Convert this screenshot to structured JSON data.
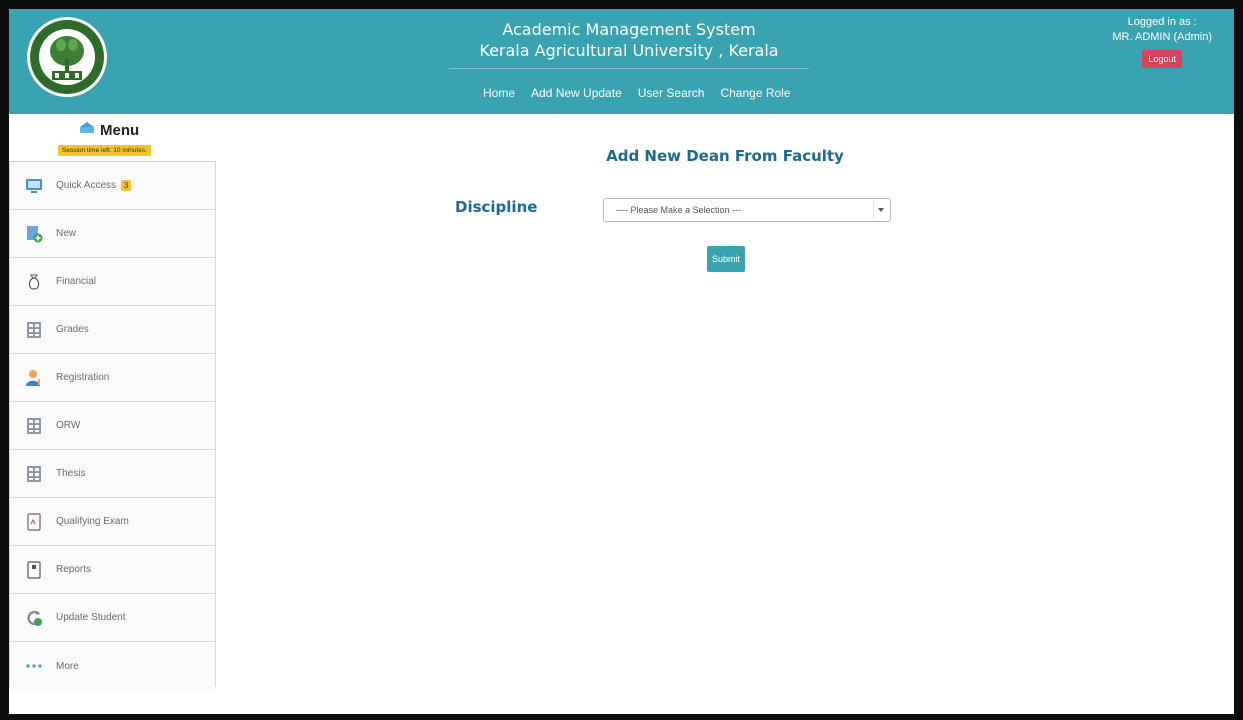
{
  "header": {
    "title_line1": "Academic Management System",
    "title_line2": "Kerala Agricultural University , Kerala",
    "nav": [
      "Home",
      "Add New Update",
      "User Search",
      "Change Role"
    ],
    "logged_in_label": "Logged in as :",
    "user": "MR. ADMIN (Admin)",
    "logout_label": "Logout",
    "accent_color": "#3aa3b1"
  },
  "sidebar": {
    "menu_label": "Menu",
    "session_text": "Session time left: 10 minutes.",
    "items": [
      {
        "label": "Quick Access",
        "badge": "3",
        "icon": "monitor-icon"
      },
      {
        "label": "New",
        "icon": "new-file-icon"
      },
      {
        "label": "Financial",
        "icon": "money-bag-icon"
      },
      {
        "label": "Grades",
        "icon": "grid-table-icon"
      },
      {
        "label": "Registration",
        "icon": "user-icon"
      },
      {
        "label": "ORW",
        "icon": "table-icon"
      },
      {
        "label": "Thesis",
        "icon": "grid-table-icon"
      },
      {
        "label": "Qualifying Exam",
        "icon": "document-icon"
      },
      {
        "label": "Reports",
        "icon": "report-icon"
      },
      {
        "label": "Update Student",
        "icon": "refresh-icon"
      },
      {
        "label": "More",
        "icon": "dots-icon"
      }
    ]
  },
  "main": {
    "page_title": "Add New Dean From Faculty",
    "discipline_label": "Discipline",
    "discipline_select": "---- Please Make a Selection ---",
    "submit_label": "Submit",
    "heading_color": "#1c6a8f",
    "badge_color": "#f4c430",
    "logout_color": "#d9435a"
  }
}
